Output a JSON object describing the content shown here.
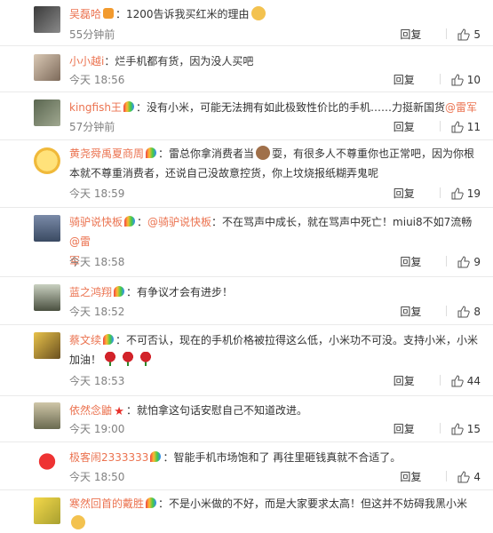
{
  "comments": [
    {
      "user": "吴磊哈",
      "text": "：1200告诉我买红米的理由",
      "time": "55分钟前",
      "likes": "5",
      "reply": "回复"
    },
    {
      "user": "小小越i",
      "text": "：烂手机都有货，因为没人买吧",
      "time": "今天 18:56",
      "likes": "10",
      "reply": "回复"
    },
    {
      "user": "kingfish王",
      "text": "：没有小米，可能无法拥有如此极致性价比的手机……力挺新国货",
      "mention": "@雷军",
      "time": "57分钟前",
      "likes": "11",
      "reply": "回复"
    },
    {
      "user": "黄尧舜禹夏商周",
      "text_a": "：雷总你拿消费者当",
      "text_b": "耍，有很多人不尊重你也正常吧，因为你根",
      "text_c": "本就不尊重消费者，还说自己没故意控货，你上坟烧报纸糊弄鬼呢",
      "time": "今天 18:59",
      "likes": "19",
      "reply": "回复"
    },
    {
      "user": "骑驴说快板",
      "text_pre": "：",
      "mention_a": "@骑驴说快板",
      "text": "：不在骂声中成长，就在骂声中死亡！miui8不如7流畅",
      "mention_b": "@雷",
      "line2": "军",
      "time": "今天 18:58",
      "likes": "9",
      "reply": "回复"
    },
    {
      "user": "蓝之鸿翔",
      "text": "：有争议才会有进步！",
      "time": "今天 18:52",
      "likes": "8",
      "reply": "回复"
    },
    {
      "user": "蔡文续",
      "text": "：不可否认，现在的手机价格被拉得这么低，小米功不可没。支持小米，小米",
      "line2": "加油！",
      "time": "今天 18:53",
      "likes": "44",
      "reply": "回复"
    },
    {
      "user": "依然念鼬",
      "text": "：就怕拿这句话安慰自己不知道改进。",
      "time": "今天 19:00",
      "likes": "15",
      "reply": "回复"
    },
    {
      "user": "极客闹2333333",
      "text": "：智能手机市场饱和了 再往里砸钱真就不合适了。",
      "time": "今天 18:50",
      "likes": "4",
      "reply": "回复"
    },
    {
      "user": "寒然回首的戴胜",
      "text": "：不是小米做的不好，而是大家要求太高！但这并不妨碍我黑小米"
    }
  ],
  "colors": {
    "username": "#eb7350",
    "time": "#808080",
    "divider": "#eaeaea"
  }
}
